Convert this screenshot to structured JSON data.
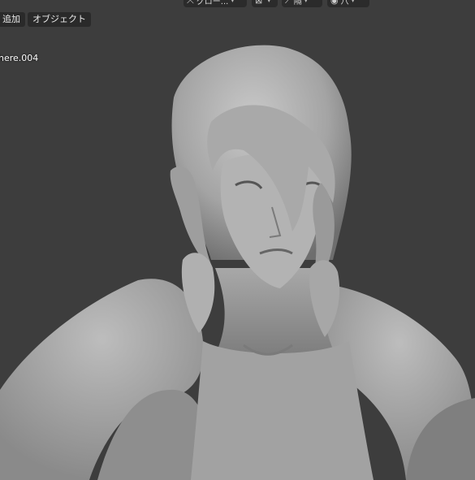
{
  "header": {
    "transform_dropdown": {
      "icon": "transform-icon",
      "label": "グロー..."
    },
    "view_dropdown": {
      "icon": "view-icon"
    },
    "snap_dropdown": {
      "icon": "snap-icon",
      "label": "隔"
    },
    "proportional_dropdown": {
      "icon": "proportional-edit-icon",
      "label": "八"
    }
  },
  "menu": {
    "add_label": "追加",
    "object_label": "オブジェクト"
  },
  "viewport": {
    "active_object_name": "here.004",
    "background_color": "#3d3d3d",
    "model_color": "#9a9a9a"
  }
}
